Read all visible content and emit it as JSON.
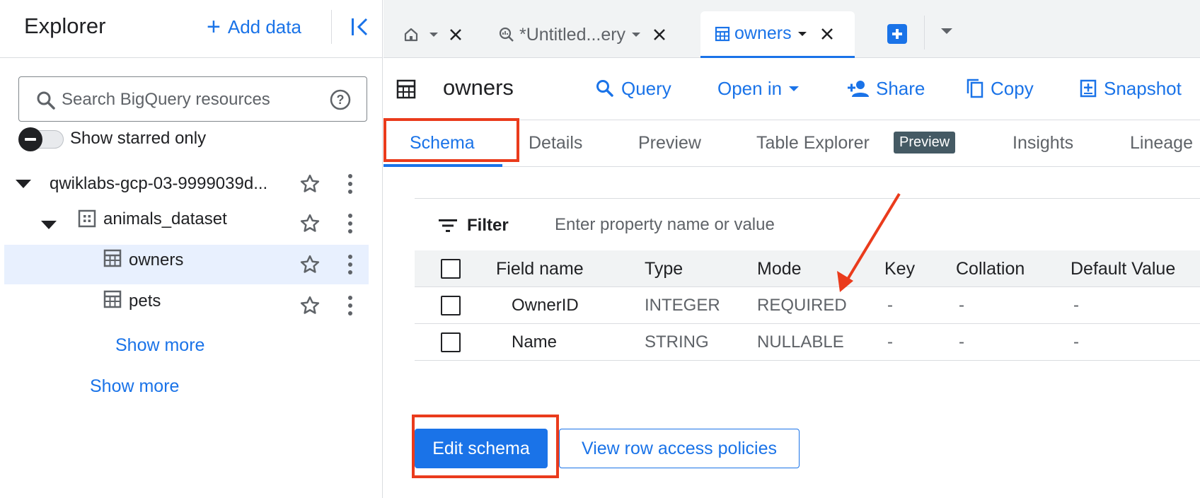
{
  "explorer": {
    "title": "Explorer",
    "add_data_label": "Add data",
    "search_placeholder": "Search BigQuery resources",
    "starred_toggle_label": "Show starred only",
    "tree": {
      "project": "qwiklabs-gcp-03-9999039d...",
      "dataset": "animals_dataset",
      "tables": [
        "owners",
        "pets"
      ],
      "dataset_show_more": "Show more",
      "project_show_more": "Show more"
    }
  },
  "editor_tabs": [
    {
      "label": "",
      "icon": "home-icon"
    },
    {
      "label": "*Untitled...ery",
      "icon": "query-icon"
    },
    {
      "label": "owners",
      "icon": "table-icon",
      "active": true
    }
  ],
  "toolbar": {
    "title": "owners",
    "query_label": "Query",
    "open_in_label": "Open in",
    "share_label": "Share",
    "copy_label": "Copy",
    "snapshot_label": "Snapshot"
  },
  "content_tabs": [
    "Schema",
    "Details",
    "Preview",
    "Table Explorer",
    "Insights",
    "Lineage"
  ],
  "preview_badge": "Preview",
  "filter": {
    "label": "Filter",
    "placeholder": "Enter property name or value"
  },
  "schema_table": {
    "columns": [
      "Field name",
      "Type",
      "Mode",
      "Key",
      "Collation",
      "Default Value"
    ],
    "rows": [
      [
        "OwnerID",
        "INTEGER",
        "REQUIRED",
        "-",
        "-",
        "-"
      ],
      [
        "Name",
        "STRING",
        "NULLABLE",
        "-",
        "-",
        "-"
      ]
    ]
  },
  "buttons": {
    "edit_schema": "Edit schema",
    "view_row_access": "View row access policies"
  },
  "colors": {
    "accent": "#1a73e8",
    "annotation": "#ea3b1c",
    "selected_row": "#e8f0fe"
  }
}
